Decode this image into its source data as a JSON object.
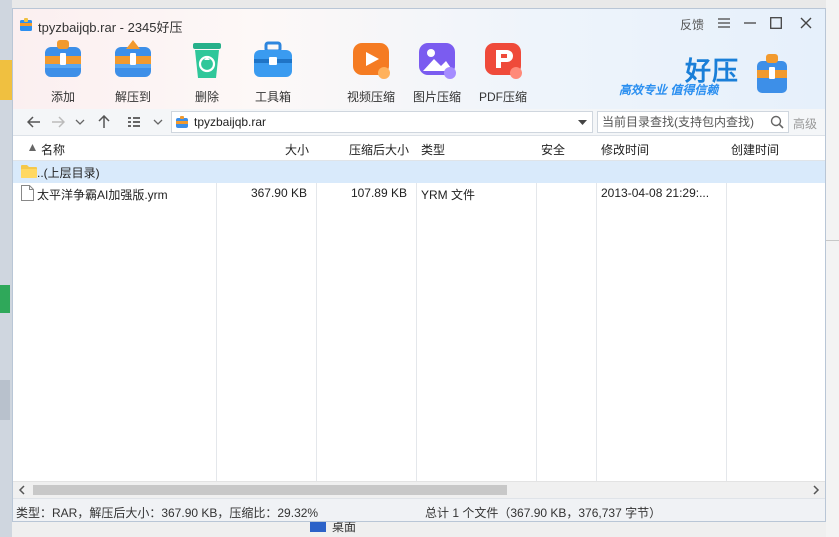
{
  "window": {
    "title": "tpyzbaijqb.rar - 2345好压",
    "feedback": "反馈"
  },
  "toolbar": {
    "add": "添加",
    "extract": "解压到",
    "delete": "删除",
    "toolbox": "工具箱",
    "video": "视频压缩",
    "image": "图片压缩",
    "pdf": "PDF压缩"
  },
  "brand": {
    "name": "好压",
    "slogan": "高效专业  值得信赖"
  },
  "address": {
    "path": "tpyzbaijqb.rar",
    "search_placeholder": "当前目录查找(支持包内查找)",
    "advanced": "高级"
  },
  "columns": {
    "name": "名称",
    "size": "大小",
    "packed": "压缩后大小",
    "type": "类型",
    "security": "安全",
    "modified": "修改时间",
    "created": "创建时间"
  },
  "rows": [
    {
      "name": "..(上层目录)",
      "size": "",
      "packed": "",
      "type": "",
      "security": "",
      "modified": "",
      "created": ""
    },
    {
      "name": "太平洋争霸AI加强版.yrm",
      "size": "367.90 KB",
      "packed": "107.89 KB",
      "type": "YRM 文件",
      "security": "",
      "modified": "2013-04-08 21:29:...",
      "created": ""
    }
  ],
  "status": {
    "left": "类型：RAR，解压后大小：367.90 KB，压缩比：29.32%",
    "right": "总计 1 个文件（367.90 KB，376,737 字节）"
  },
  "desktop": {
    "bottom_text": "桌面"
  },
  "colors": {
    "selected_row": "#d9eafb",
    "brand_blue": "#1a7fd8"
  }
}
